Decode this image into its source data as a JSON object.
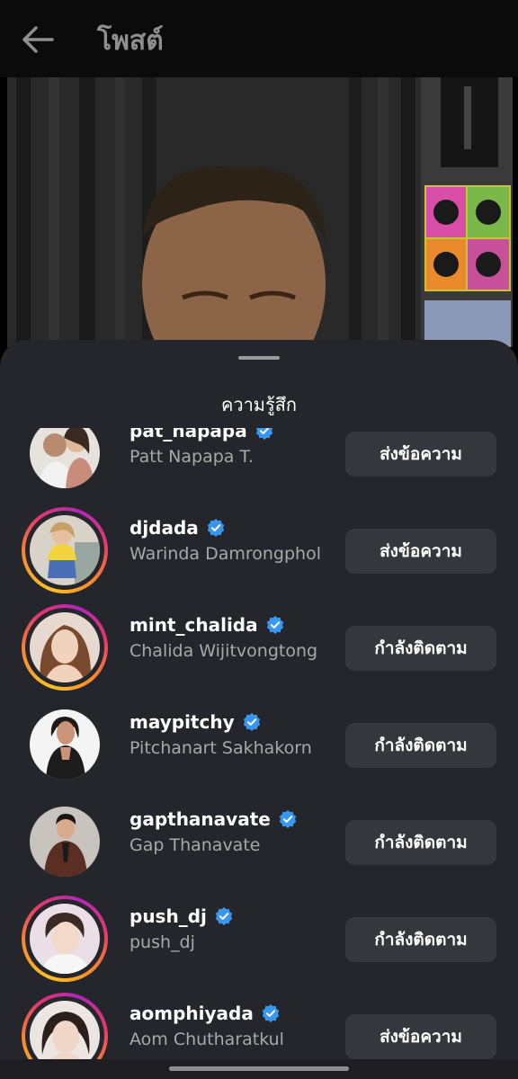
{
  "header": {
    "title": "โพสต์"
  },
  "sheet": {
    "title": "ความรู้สึก"
  },
  "users": [
    {
      "username": "pat_napapa",
      "full_name": "Patt Napapa T.",
      "action": "ส่งข้อความ",
      "story_ring": false
    },
    {
      "username": "djdada",
      "full_name": "Warinda Damrongphol",
      "action": "ส่งข้อความ",
      "story_ring": true
    },
    {
      "username": "mint_chalida",
      "full_name": "Chalida Wijitvongtong",
      "action": "กำลังติดตาม",
      "story_ring": true
    },
    {
      "username": "maypitchy",
      "full_name": "Pitchanart Sakhakorn",
      "action": "กำลังติดตาม",
      "story_ring": false
    },
    {
      "username": "gapthanavate",
      "full_name": "Gap Thanavate",
      "action": "กำลังติดตาม",
      "story_ring": false
    },
    {
      "username": "push_dj",
      "full_name": "push_dj",
      "action": "กำลังติดตาม",
      "story_ring": true
    },
    {
      "username": "aomphiyada",
      "full_name": "Aom Chutharatkul",
      "action": "ส่งข้อความ",
      "story_ring": true
    }
  ],
  "colors": {
    "verified": "#3897f0",
    "button_bg": "#36373c",
    "sheet_bg": "#25262b"
  }
}
